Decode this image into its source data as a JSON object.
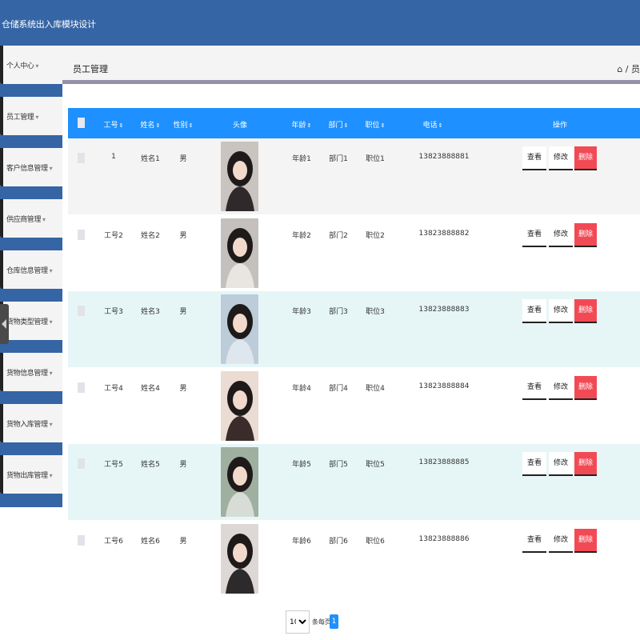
{
  "app": {
    "title": "仓储系统出入库模块设计"
  },
  "sidebar": {
    "items": [
      {
        "label": "个人中心"
      },
      {
        "label": "员工管理"
      },
      {
        "label": "客户信息管理"
      },
      {
        "label": "供应商管理"
      },
      {
        "label": "仓库信息管理"
      },
      {
        "label": "货物类型管理"
      },
      {
        "label": "货物信息管理"
      },
      {
        "label": "货物入库管理"
      },
      {
        "label": "货物出库管理"
      }
    ],
    "arrow": "▾"
  },
  "header": {
    "page_title": "员工管理",
    "breadcrumb": "⌂ / 员"
  },
  "table": {
    "columns": [
      "工号",
      "姓名",
      "性别",
      "头像",
      "年龄",
      "部门",
      "职位",
      "电话",
      "操作"
    ],
    "sort_glyph": "⇕",
    "rows": [
      {
        "id": "1",
        "name": "姓名1",
        "gender": "男",
        "age": "年龄1",
        "dept": "部门1",
        "position": "职位1",
        "phone": "13823888881",
        "bg": "#f4f4f4"
      },
      {
        "id": "工号2",
        "name": "姓名2",
        "gender": "男",
        "age": "年龄2",
        "dept": "部门2",
        "position": "职位2",
        "phone": "13823888882",
        "bg": "#ffffff"
      },
      {
        "id": "工号3",
        "name": "姓名3",
        "gender": "男",
        "age": "年龄3",
        "dept": "部门3",
        "position": "职位3",
        "phone": "13823888883",
        "bg": "#e6f6f7"
      },
      {
        "id": "工号4",
        "name": "姓名4",
        "gender": "男",
        "age": "年龄4",
        "dept": "部门4",
        "position": "职位4",
        "phone": "13823888884",
        "bg": "#ffffff"
      },
      {
        "id": "工号5",
        "name": "姓名5",
        "gender": "男",
        "age": "年龄5",
        "dept": "部门5",
        "position": "职位5",
        "phone": "13823888885",
        "bg": "#e6f6f7"
      },
      {
        "id": "工号6",
        "name": "姓名6",
        "gender": "男",
        "age": "年龄6",
        "dept": "部门6",
        "position": "职位6",
        "phone": "13823888886",
        "bg": "#ffffff"
      }
    ],
    "actions": {
      "view": "查看",
      "edit": "修改",
      "delete": "删除"
    }
  },
  "pagination": {
    "page_size": "10",
    "per_page_label": "条每页",
    "current_page": "1"
  },
  "colors": {
    "brand": "#3565a5",
    "table_header": "#1e90ff",
    "danger": "#f24a55"
  }
}
